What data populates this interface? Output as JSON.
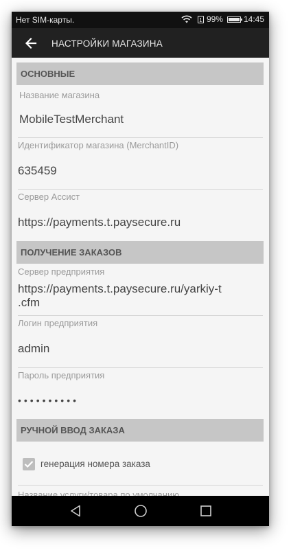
{
  "status_bar": {
    "carrier": "Нет SIM-карты.",
    "battery": "99%",
    "battery_level": 0.99,
    "time": "14:45"
  },
  "toolbar": {
    "title": "НАСТРОЙКИ МАГАЗИНА"
  },
  "sections": {
    "main": "ОСНОВНЫЕ",
    "orders": "ПОЛУЧЕНИЕ ЗАКАЗОВ",
    "manual": "РУЧНОЙ ВВОД ЗАКАЗА"
  },
  "fields": {
    "shop_name": {
      "label": "Название магазина",
      "value": "MobileTestMerchant"
    },
    "merchant_id": {
      "label": "Идентификатор магазина (MerchantID)",
      "value": "635459"
    },
    "assist_server": {
      "label": "Сервер Ассист",
      "value": "https://payments.t.paysecure.ru"
    },
    "enterprise_server": {
      "label": "Сервер предприятия",
      "value": "https://payments.t.paysecure.ru/yarkiy-t\n.cfm"
    },
    "enterprise_login": {
      "label": "Логин предприятия",
      "value": "admin"
    },
    "enterprise_password": {
      "label": "Пароль предприятия",
      "value": "••••••••••"
    }
  },
  "manual": {
    "generate_order_number": {
      "label": "генерация номера заказа",
      "checked": true
    },
    "default_service_label": "Название услуги/товара по умолчанию"
  },
  "navbar": {
    "back_icon": "triangle-back-icon",
    "home_icon": "circle-home-icon",
    "recents_icon": "square-recents-icon"
  }
}
